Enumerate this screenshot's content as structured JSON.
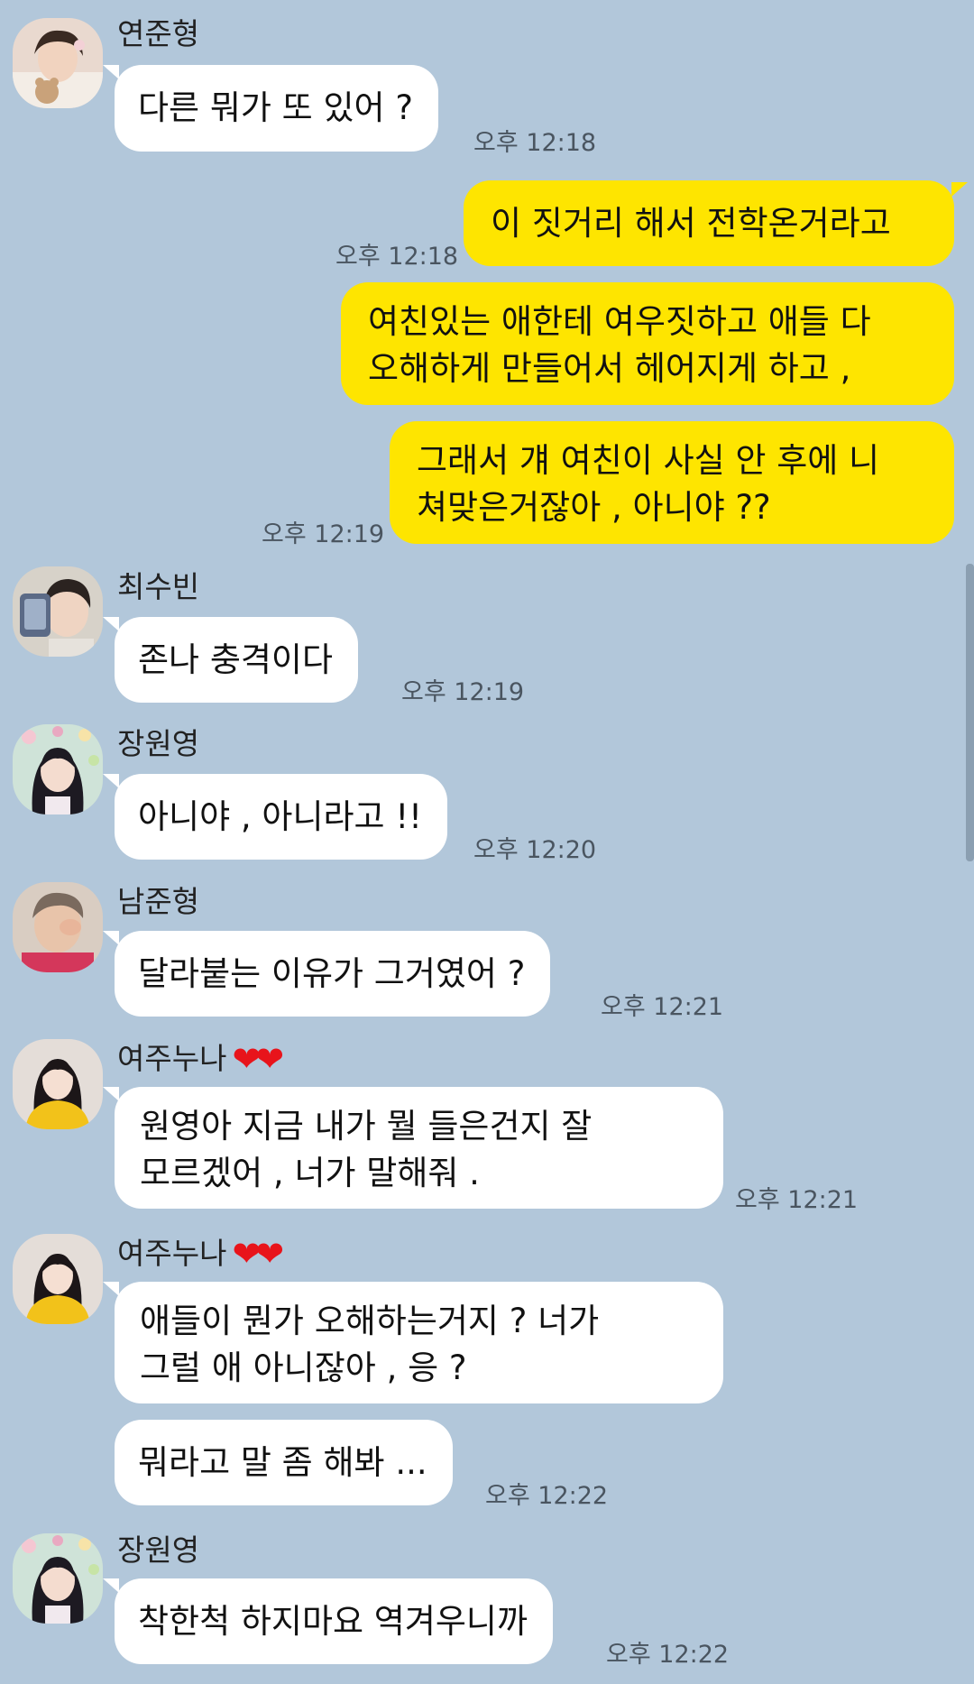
{
  "chat": {
    "messages": [
      {
        "sender": "연준형",
        "text": "다른 뭐가 또 있어 ?",
        "time": "오후 12:18"
      },
      {
        "sender": "me",
        "text": "이 짓거리 해서 전학온거라고",
        "time": "오후 12:18"
      },
      {
        "sender": "me",
        "lines": [
          "여친있는 애한테 여우짓하고 애들 다",
          "오해하게 만들어서 헤어지게 하고 ,"
        ]
      },
      {
        "sender": "me",
        "lines": [
          "그래서 걔 여친이 사실 안 후에 니",
          "쳐맞은거잖아 , 아니야 ??"
        ],
        "time": "오후 12:19"
      },
      {
        "sender": "최수빈",
        "text": "존나 충격이다",
        "time": "오후 12:19"
      },
      {
        "sender": "장원영",
        "text": "아니야 , 아니라고 !!",
        "time": "오후 12:20"
      },
      {
        "sender": "남준형",
        "text": "달라붙는 이유가 그거였어 ?",
        "time": "오후 12:21"
      },
      {
        "sender": "여주누나",
        "hearts": "❤❤",
        "lines": [
          "원영아 지금 내가 뭘 들은건지 잘",
          "모르겠어 , 너가 말해줘 ."
        ],
        "time": "오후 12:21"
      },
      {
        "sender": "여주누나",
        "hearts": "❤❤",
        "lines": [
          "애들이 뭔가 오해하는거지 ? 너가",
          "그럴 애 아니잖아 , 응 ?"
        ]
      },
      {
        "sender": "여주누나",
        "text": "뭐라고 말 좀 해봐 ...",
        "time": "오후 12:22"
      },
      {
        "sender": "장원영",
        "text": "착한척 하지마요 역겨우니까",
        "time": "오후 12:22"
      }
    ]
  },
  "avatars": {
    "yeonjun": {
      "icon": "profile-photo-boy-with-plush"
    },
    "soobin": {
      "icon": "profile-photo-boy-with-phone"
    },
    "wonyoung": {
      "icon": "profile-photo-girl-with-flowers"
    },
    "namjoon": {
      "icon": "profile-photo-man-pink-shirt"
    },
    "yeoju": {
      "icon": "profile-photo-girl-yellow-sweater"
    }
  },
  "colors": {
    "background": "#b2c7da",
    "incoming_bubble": "#ffffff",
    "outgoing_bubble": "#fee500",
    "heart": "#e8141b"
  }
}
